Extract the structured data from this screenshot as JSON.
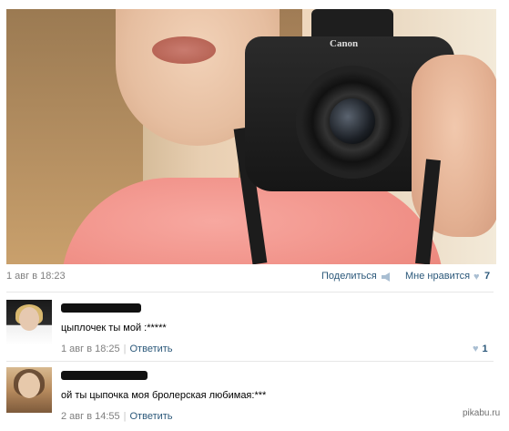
{
  "post": {
    "date": "1 авг в 18:23",
    "share_label": "Поделиться",
    "like_label": "Мне нравится",
    "like_count": "7"
  },
  "photo": {
    "camera_brand": "Canon"
  },
  "comments": [
    {
      "text": "цыплочек ты мой :*****",
      "date": "1 авг в 18:25",
      "reply_label": "Ответить",
      "like_count": "1"
    },
    {
      "text": "ой ты цыпочка моя бролерская любимая:***",
      "date": "2 авг в 14:55",
      "reply_label": "Ответить"
    }
  ],
  "watermark": "pikabu.ru",
  "colors": {
    "link": "#2b587a",
    "muted": "#7f7f7f",
    "heart": "#a9bed2"
  }
}
